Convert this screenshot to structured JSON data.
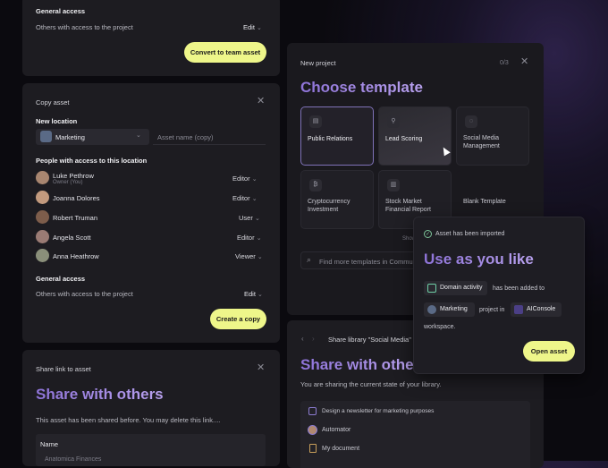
{
  "top_card": {
    "general_access": "General access",
    "others_text": "Others with access to the project",
    "edit": "Edit",
    "convert_button": "Convert to team asset"
  },
  "copy_card": {
    "title": "Copy asset",
    "new_location": "New location",
    "location_value": "Marketing",
    "asset_name_placeholder": "Asset name (copy)",
    "people_heading": "People with access to this location",
    "people": [
      {
        "name": "Luke Pethrow",
        "sub": "Owner (You)",
        "role": "Editor"
      },
      {
        "name": "Joanna Dolores",
        "sub": "",
        "role": "Editor"
      },
      {
        "name": "Robert Truman",
        "sub": "",
        "role": "User"
      },
      {
        "name": "Angela Scott",
        "sub": "",
        "role": "Editor"
      },
      {
        "name": "Anna Heathrow",
        "sub": "",
        "role": "Viewer"
      }
    ],
    "general_access": "General access",
    "others_text": "Others with access to the project",
    "edit": "Edit",
    "create_button": "Create a copy"
  },
  "share_link_card": {
    "title": "Share link to asset",
    "heading": "Share with others",
    "desc": "This asset has been shared before. You may delete this link....",
    "name_label": "Name",
    "name_value": "Anatomica Finances"
  },
  "template_card": {
    "title": "New project",
    "step": "0/3",
    "heading": "Choose template",
    "tiles": [
      {
        "label": "Public Relations",
        "icon": "▤"
      },
      {
        "label": "Lead Scoring",
        "icon": "⚲"
      },
      {
        "label": "Social Media Management",
        "icon": "◌"
      },
      {
        "label": "Cryptocurrency Investment",
        "icon": "₿"
      },
      {
        "label": "Stock Market Financial Report",
        "icon": "▥"
      },
      {
        "label": "Blank Template",
        "icon": ""
      }
    ],
    "show_more": "Show",
    "search_placeholder": "Find more templates in Commu"
  },
  "share_library_card": {
    "title": "Share library \"Social Media\"",
    "heading": "Share with othe",
    "desc": "You are sharing the current state of your library.",
    "items": [
      "Design a newsletter for marketing purposes",
      "Automator",
      "My document"
    ]
  },
  "import_card": {
    "status": "Asset has been imported",
    "heading": "Use as you like",
    "chip_activity": "Domain activity",
    "text_added": "has been added to",
    "chip_marketing": "Marketing",
    "text_project_in": "project in",
    "chip_console": "AIConsole",
    "text_workspace": "workspace.",
    "open_button": "Open asset"
  }
}
